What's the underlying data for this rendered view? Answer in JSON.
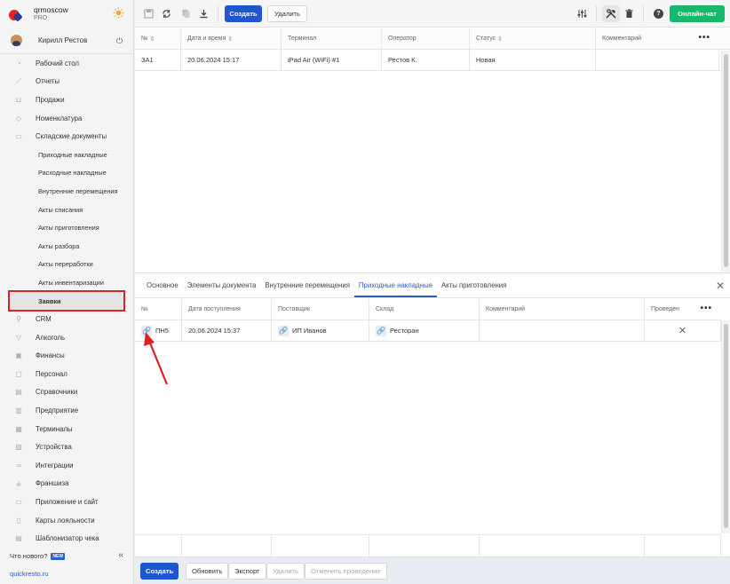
{
  "brand": {
    "name": "qrmoscow",
    "plan": "PRO"
  },
  "user": {
    "name": "Кирилл Рестов"
  },
  "sidebar": {
    "items": [
      {
        "label": "Рабочий стол",
        "icon": "speedometer-icon"
      },
      {
        "label": "Отчеты",
        "icon": "chart-icon"
      },
      {
        "label": "Продажи",
        "icon": "basket-icon"
      },
      {
        "label": "Номенклатура",
        "icon": "tag-icon"
      },
      {
        "label": "Складские документы",
        "icon": "box-icon"
      }
    ],
    "subitems": [
      {
        "label": "Приходные накладные"
      },
      {
        "label": "Расходные накладные"
      },
      {
        "label": "Внутренние перемещения"
      },
      {
        "label": "Акты списания"
      },
      {
        "label": "Акты приготовления"
      },
      {
        "label": "Акты разбора"
      },
      {
        "label": "Акты переработки"
      },
      {
        "label": "Акты инвентаризации"
      },
      {
        "label": "Заявки"
      }
    ],
    "items2": [
      {
        "label": "CRM",
        "icon": "crm-icon"
      },
      {
        "label": "Алкоголь",
        "icon": "glass-icon"
      },
      {
        "label": "Финансы",
        "icon": "wallet-icon"
      },
      {
        "label": "Персонал",
        "icon": "person-icon"
      },
      {
        "label": "Справочники",
        "icon": "book-icon"
      },
      {
        "label": "Предприятие",
        "icon": "building-icon"
      },
      {
        "label": "Терминалы",
        "icon": "terminal-icon"
      },
      {
        "label": "Устройства",
        "icon": "device-icon"
      },
      {
        "label": "Интеграции",
        "icon": "link-icon"
      },
      {
        "label": "Франшиза",
        "icon": "franchise-icon"
      },
      {
        "label": "Приложение и сайт",
        "icon": "app-icon"
      },
      {
        "label": "Карты лояльности",
        "icon": "card-icon"
      },
      {
        "label": "Шаблонизатор чека",
        "icon": "receipt-icon"
      }
    ],
    "whats_new": "Что нового?",
    "new_badge": "NEW",
    "site_url": "quickresto.ru"
  },
  "toolbar": {
    "create_label": "Создать",
    "delete_label": "Удалить",
    "chat_label": "Онлайн-чат"
  },
  "grid": {
    "columns": [
      "№",
      "Дата и время",
      "Терминал",
      "Оператор",
      "Статус",
      "Комментарий"
    ],
    "rows": [
      {
        "number": "ЗА1",
        "datetime": "20.06.2024 15:17",
        "terminal": "iPad Air (WiFi) #1",
        "operator": "Рестов К.",
        "status": "Новая",
        "comment": ""
      }
    ]
  },
  "panel": {
    "tabs": [
      "Основное",
      "Элементы документа",
      "Внутренние перемещения",
      "Приходные накладные",
      "Акты приготовления"
    ],
    "active_tab": 3,
    "columns": [
      "№",
      "Дата поступления",
      "Поставщик",
      "Склад",
      "Комментарий",
      "Проведен"
    ],
    "rows": [
      {
        "number": "ПН5",
        "date": "20.06.2024 15:37",
        "supplier": "ИП Иванов",
        "warehouse": "Ресторан",
        "comment": "",
        "posted": "✕"
      }
    ]
  },
  "bottombar": {
    "create": "Создать",
    "refresh": "Обновить",
    "export": "Экспорт",
    "delete": "Удалить",
    "unpost": "Отменить проведение"
  }
}
